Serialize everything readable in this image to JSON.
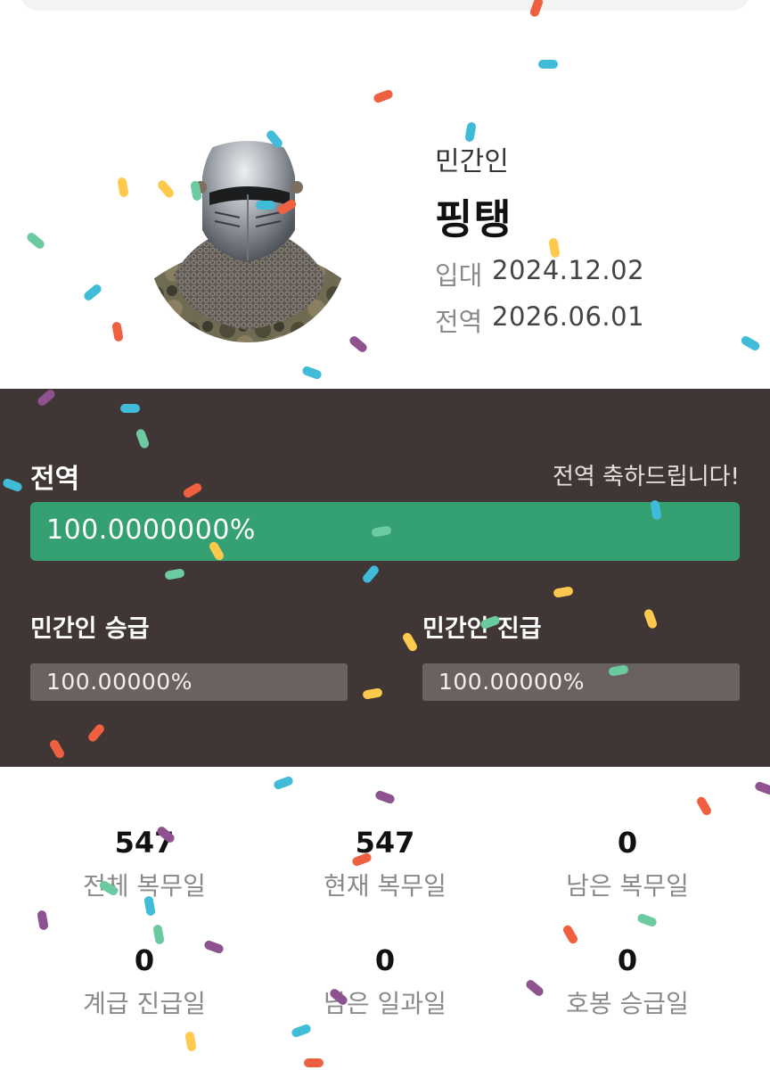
{
  "profile": {
    "rank": "민간인",
    "name": "핑탱",
    "enlist_label": "입대",
    "enlist_date": "2024.12.02",
    "discharge_label": "전역",
    "discharge_date": "2026.06.01",
    "avatar_icon": "knight-helmet-avatar"
  },
  "progress": {
    "title": "전역",
    "message": "전역 축하드립니다!",
    "value_text": "100.0000000%",
    "value": 100,
    "color": "#35a071",
    "subs": [
      {
        "title": "민간인 승급",
        "value_text": "100.00000%",
        "value": 100
      },
      {
        "title": "민간인 진급",
        "value_text": "100.00000%",
        "value": 100
      }
    ]
  },
  "stats": [
    {
      "value": "547",
      "label": "전체 복무일"
    },
    {
      "value": "547",
      "label": "현재 복무일"
    },
    {
      "value": "0",
      "label": "남은 복무일"
    },
    {
      "value": "0",
      "label": "계급 진급일"
    },
    {
      "value": "0",
      "label": "남은 일과일"
    },
    {
      "value": "0",
      "label": "호봉 승급일"
    }
  ],
  "colors": {
    "panel_bg": "#3f3635",
    "accent_green": "#35a071",
    "confetti": [
      "#ef6040",
      "#41bcd8",
      "#ffc94d",
      "#6ccaa0",
      "#8e5290"
    ]
  }
}
